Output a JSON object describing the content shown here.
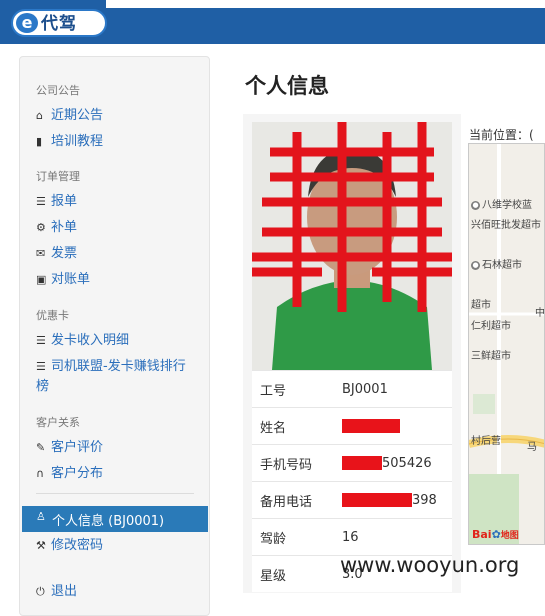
{
  "brand": {
    "logo_mark": "e",
    "logo_text": "代驾"
  },
  "sidebar": {
    "sections": [
      {
        "title": "公司公告",
        "items": [
          {
            "label": "近期公告",
            "icon": "home-icon"
          },
          {
            "label": "培训教程",
            "icon": "book-icon"
          }
        ]
      },
      {
        "title": "订单管理",
        "items": [
          {
            "label": "报单",
            "icon": "list-icon"
          },
          {
            "label": "补单",
            "icon": "gear-icon"
          },
          {
            "label": "发票",
            "icon": "envelope-icon"
          },
          {
            "label": "对账单",
            "icon": "file-icon"
          }
        ]
      },
      {
        "title": "优惠卡",
        "items": [
          {
            "label": "发卡收入明细",
            "icon": "list-icon"
          },
          {
            "label": "司机联盟-发卡赚钱排行榜",
            "icon": "list-icon"
          }
        ]
      },
      {
        "title": "客户关系",
        "items": [
          {
            "label": "客户评价",
            "icon": "pencil-icon"
          },
          {
            "label": "客户分布",
            "icon": "headphones-icon"
          }
        ]
      }
    ],
    "account_items": [
      {
        "label": "个人信息 (BJ0001)",
        "icon": "user-icon",
        "active": true
      },
      {
        "label": "修改密码",
        "icon": "wrench-icon"
      },
      {
        "label": "退出",
        "icon": "power-icon"
      }
    ]
  },
  "main": {
    "title": "个人信息",
    "info": [
      {
        "label": "工号",
        "value": "BJ0001"
      },
      {
        "label": "姓名",
        "value": ""
      },
      {
        "label": "手机号码",
        "value": "505426"
      },
      {
        "label": "备用电话",
        "value": "398"
      },
      {
        "label": "驾龄",
        "value": "16"
      },
      {
        "label": "星级",
        "value": "3.0"
      }
    ],
    "location_label": "当前位置：(",
    "map_labels": [
      "八维学校蓝",
      "兴佰旺批发超市",
      "石林超市",
      "超市",
      "仁利超市",
      "三鲜超市",
      "村后营",
      "马",
      "中"
    ],
    "map_brand": "Bai",
    "map_brand_suffix": "地图"
  },
  "watermark": "www.wooyun.org"
}
